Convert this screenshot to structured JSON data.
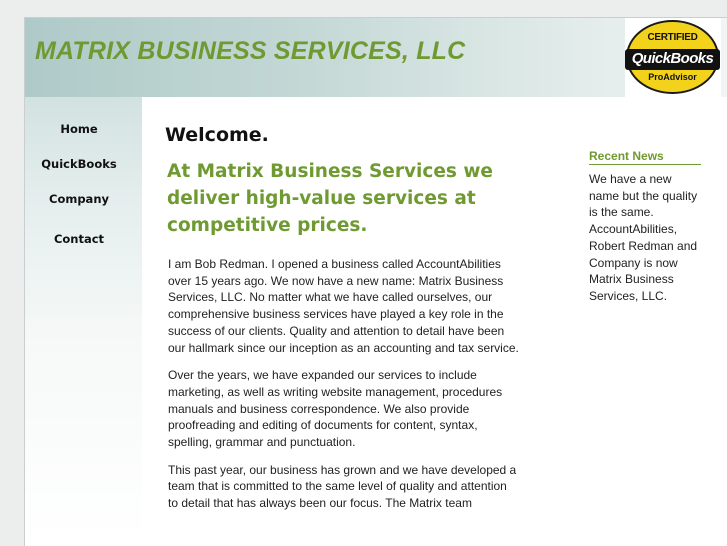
{
  "header": {
    "title": "MATRIX BUSINESS SERVICES, LLC",
    "badge": {
      "line1": "CERTIFIED",
      "line2": "QuickBooks",
      "line3": "ProAdvisor"
    }
  },
  "nav": {
    "items": [
      {
        "label": "Home"
      },
      {
        "label": "QuickBooks"
      },
      {
        "label": "Company"
      },
      {
        "label": "Contact"
      }
    ]
  },
  "main": {
    "heading": "Welcome.",
    "tagline": "At Matrix Business Services we deliver high-value services at competitive prices.",
    "paragraphs": [
      "I am Bob Redman. I opened a business called AccountAbilities over 15 years ago. We now have a new name: Matrix Business Services, LLC. No matter what we have called ourselves, our comprehensive business services have played a key role in the success of our clients. Quality and attention to detail have been our hallmark since our inception as an accounting and tax service.",
      "Over the years, we have expanded our services to include marketing, as well as writing website management, procedures manuals and business correspondence. We also provide proofreading and editing of documents for content, syntax, spelling, grammar and punctuation.",
      "This past year, our business has grown and we have developed a team that is committed to the same level of quality and attention to detail that has always been our focus. The Matrix team"
    ]
  },
  "news": {
    "heading": "Recent News",
    "body": "We have a new name but the quality is the same. AccountAbilities, Robert Redman and Company is now Matrix Business Services, LLC."
  },
  "colors": {
    "accent_green": "#6f9a32",
    "header_teal": "#aecac8",
    "badge_yellow": "#f2d21a"
  }
}
